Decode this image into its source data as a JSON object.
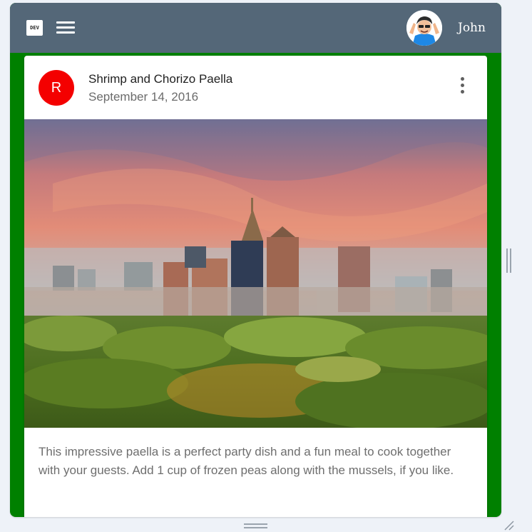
{
  "appbar": {
    "logo_text": "DEV",
    "menu_icon": "hamburger-menu-icon",
    "user_name": "John",
    "user_avatar": "cartoon-avatar",
    "color": "#546778"
  },
  "frame": {
    "background_color": "#008000"
  },
  "card": {
    "avatar_letter": "R",
    "avatar_color": "#f40000",
    "title": "Shrimp and Chorizo Paella",
    "subheader": "September 14, 2016",
    "action_icon": "more-vertical-icon",
    "media": "city-skyline-photo",
    "body": "This impressive paella is a perfect party dish and a fun meal to cook together with your guests. Add 1 cup of frozen peas along with the mussels, if you like."
  },
  "window_controls": {
    "scroll_handle_icon": "vertical-grip-icon",
    "drag_bar_icon": "horizontal-grip-icon",
    "resize_icon": "resize-grip-icon"
  }
}
